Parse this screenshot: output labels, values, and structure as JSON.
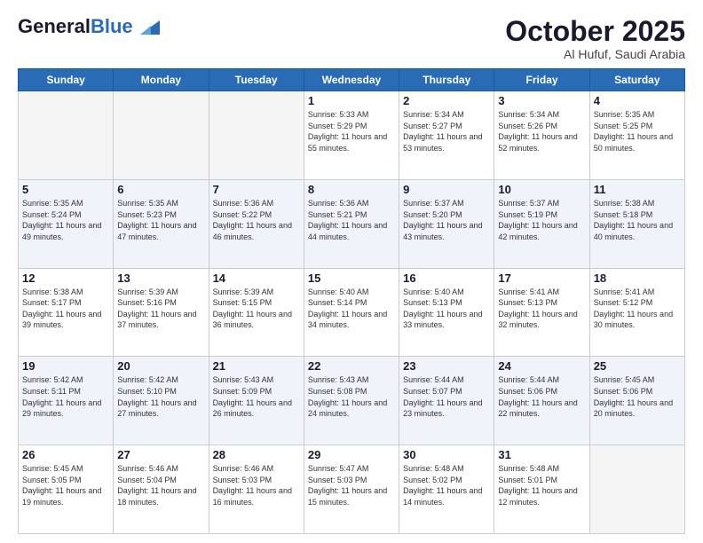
{
  "header": {
    "logo_general": "General",
    "logo_blue": "Blue",
    "month_title": "October 2025",
    "subtitle": "Al Hufuf, Saudi Arabia"
  },
  "days_of_week": [
    "Sunday",
    "Monday",
    "Tuesday",
    "Wednesday",
    "Thursday",
    "Friday",
    "Saturday"
  ],
  "weeks": [
    [
      {
        "day": "",
        "empty": true
      },
      {
        "day": "",
        "empty": true
      },
      {
        "day": "",
        "empty": true
      },
      {
        "day": "1",
        "sunrise": "5:33 AM",
        "sunset": "5:29 PM",
        "daylight": "11 hours and 55 minutes."
      },
      {
        "day": "2",
        "sunrise": "5:34 AM",
        "sunset": "5:27 PM",
        "daylight": "11 hours and 53 minutes."
      },
      {
        "day": "3",
        "sunrise": "5:34 AM",
        "sunset": "5:26 PM",
        "daylight": "11 hours and 52 minutes."
      },
      {
        "day": "4",
        "sunrise": "5:35 AM",
        "sunset": "5:25 PM",
        "daylight": "11 hours and 50 minutes."
      }
    ],
    [
      {
        "day": "5",
        "sunrise": "5:35 AM",
        "sunset": "5:24 PM",
        "daylight": "11 hours and 49 minutes."
      },
      {
        "day": "6",
        "sunrise": "5:35 AM",
        "sunset": "5:23 PM",
        "daylight": "11 hours and 47 minutes."
      },
      {
        "day": "7",
        "sunrise": "5:36 AM",
        "sunset": "5:22 PM",
        "daylight": "11 hours and 46 minutes."
      },
      {
        "day": "8",
        "sunrise": "5:36 AM",
        "sunset": "5:21 PM",
        "daylight": "11 hours and 44 minutes."
      },
      {
        "day": "9",
        "sunrise": "5:37 AM",
        "sunset": "5:20 PM",
        "daylight": "11 hours and 43 minutes."
      },
      {
        "day": "10",
        "sunrise": "5:37 AM",
        "sunset": "5:19 PM",
        "daylight": "11 hours and 42 minutes."
      },
      {
        "day": "11",
        "sunrise": "5:38 AM",
        "sunset": "5:18 PM",
        "daylight": "11 hours and 40 minutes."
      }
    ],
    [
      {
        "day": "12",
        "sunrise": "5:38 AM",
        "sunset": "5:17 PM",
        "daylight": "11 hours and 39 minutes."
      },
      {
        "day": "13",
        "sunrise": "5:39 AM",
        "sunset": "5:16 PM",
        "daylight": "11 hours and 37 minutes."
      },
      {
        "day": "14",
        "sunrise": "5:39 AM",
        "sunset": "5:15 PM",
        "daylight": "11 hours and 36 minutes."
      },
      {
        "day": "15",
        "sunrise": "5:40 AM",
        "sunset": "5:14 PM",
        "daylight": "11 hours and 34 minutes."
      },
      {
        "day": "16",
        "sunrise": "5:40 AM",
        "sunset": "5:13 PM",
        "daylight": "11 hours and 33 minutes."
      },
      {
        "day": "17",
        "sunrise": "5:41 AM",
        "sunset": "5:13 PM",
        "daylight": "11 hours and 32 minutes."
      },
      {
        "day": "18",
        "sunrise": "5:41 AM",
        "sunset": "5:12 PM",
        "daylight": "11 hours and 30 minutes."
      }
    ],
    [
      {
        "day": "19",
        "sunrise": "5:42 AM",
        "sunset": "5:11 PM",
        "daylight": "11 hours and 29 minutes."
      },
      {
        "day": "20",
        "sunrise": "5:42 AM",
        "sunset": "5:10 PM",
        "daylight": "11 hours and 27 minutes."
      },
      {
        "day": "21",
        "sunrise": "5:43 AM",
        "sunset": "5:09 PM",
        "daylight": "11 hours and 26 minutes."
      },
      {
        "day": "22",
        "sunrise": "5:43 AM",
        "sunset": "5:08 PM",
        "daylight": "11 hours and 24 minutes."
      },
      {
        "day": "23",
        "sunrise": "5:44 AM",
        "sunset": "5:07 PM",
        "daylight": "11 hours and 23 minutes."
      },
      {
        "day": "24",
        "sunrise": "5:44 AM",
        "sunset": "5:06 PM",
        "daylight": "11 hours and 22 minutes."
      },
      {
        "day": "25",
        "sunrise": "5:45 AM",
        "sunset": "5:06 PM",
        "daylight": "11 hours and 20 minutes."
      }
    ],
    [
      {
        "day": "26",
        "sunrise": "5:45 AM",
        "sunset": "5:05 PM",
        "daylight": "11 hours and 19 minutes."
      },
      {
        "day": "27",
        "sunrise": "5:46 AM",
        "sunset": "5:04 PM",
        "daylight": "11 hours and 18 minutes."
      },
      {
        "day": "28",
        "sunrise": "5:46 AM",
        "sunset": "5:03 PM",
        "daylight": "11 hours and 16 minutes."
      },
      {
        "day": "29",
        "sunrise": "5:47 AM",
        "sunset": "5:03 PM",
        "daylight": "11 hours and 15 minutes."
      },
      {
        "day": "30",
        "sunrise": "5:48 AM",
        "sunset": "5:02 PM",
        "daylight": "11 hours and 14 minutes."
      },
      {
        "day": "31",
        "sunrise": "5:48 AM",
        "sunset": "5:01 PM",
        "daylight": "11 hours and 12 minutes."
      },
      {
        "day": "",
        "empty": true
      }
    ]
  ],
  "labels": {
    "sunrise": "Sunrise:",
    "sunset": "Sunset:",
    "daylight": "Daylight:"
  }
}
